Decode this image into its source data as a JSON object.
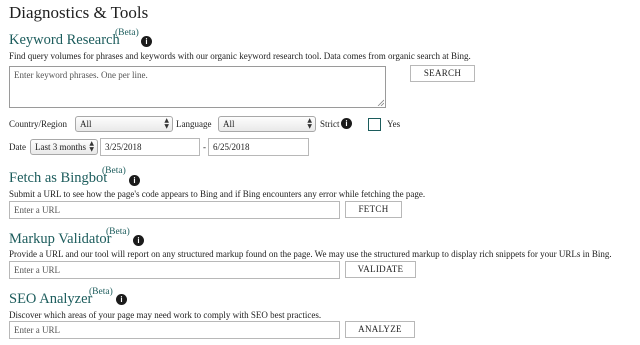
{
  "page": {
    "title": "Diagnostics & Tools"
  },
  "keyword_research": {
    "title": "Keyword Research",
    "beta": "(Beta)",
    "description": "Find query volumes for phrases and keywords with our organic keyword research tool. Data comes from organic search at Bing.",
    "textarea_placeholder": "Enter keyword phrases. One per line.",
    "search_button": "SEARCH",
    "country_label": "Country/Region",
    "country_value": "All",
    "language_label": "Language",
    "language_value": "All",
    "strict_label": "Strict",
    "yes_label": "Yes",
    "date_label": "Date",
    "date_range_value": "Last 3 months",
    "start_date": "3/25/2018",
    "date_separator": "-",
    "end_date": "6/25/2018"
  },
  "fetch_as_bingbot": {
    "title": "Fetch as Bingbot",
    "beta": "(Beta)",
    "description": "Submit a URL to see how the page's code appears to Bing and if Bing encounters any error while fetching the page.",
    "url_placeholder": "Enter a URL",
    "button": "FETCH"
  },
  "markup_validator": {
    "title": "Markup Validator",
    "beta": "(Beta)",
    "description": "Provide a URL and our tool will report on any structured markup found on the page. We may use the structured markup to display rich snippets for your URLs in Bing.",
    "url_placeholder": "Enter a URL",
    "button": "VALIDATE"
  },
  "seo_analyzer": {
    "title": "SEO Analyzer",
    "beta": "(Beta)",
    "description": "Discover which areas of your page may need work to comply with SEO best practices.",
    "url_placeholder": "Enter a URL",
    "button": "ANALYZE"
  },
  "icons": {
    "info": "info-icon",
    "select_arrows": "updown-arrows-icon",
    "resize": "resize-grip-icon"
  },
  "colors": {
    "heading": "#1c5c5c",
    "checkbox_border": "#1c5c5c"
  }
}
